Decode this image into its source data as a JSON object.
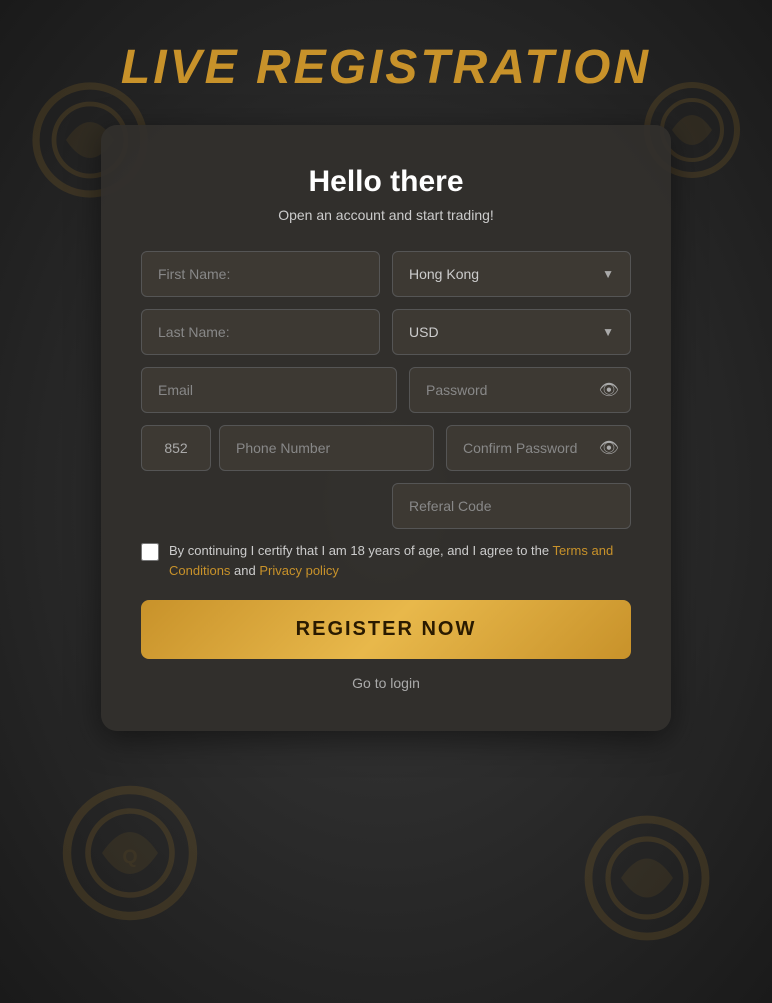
{
  "page": {
    "title": "LIVE REGISTRATION",
    "background_color": "#2a2a2a"
  },
  "form": {
    "heading": "Hello there",
    "subtitle": "Open an account and start trading!",
    "first_name_placeholder": "First Name:",
    "last_name_placeholder": "Last Name:",
    "email_placeholder": "Email",
    "password_placeholder": "Password",
    "phone_code": "852",
    "phone_placeholder": "Phone Number",
    "confirm_password_placeholder": "Confirm Password",
    "referral_placeholder": "Referal Code",
    "country_default": "Hong Kong",
    "currency_default": "USD",
    "checkbox_text_before": "By continuing I certify that I am 18 years of age, and I agree to the ",
    "terms_label": "Terms and Conditions",
    "and_text": " and ",
    "privacy_label": "Privacy policy",
    "register_button": "REGISTER NOW",
    "goto_login": "Go to login"
  },
  "icons": {
    "eye": "👁",
    "chevron_down": "▼"
  }
}
